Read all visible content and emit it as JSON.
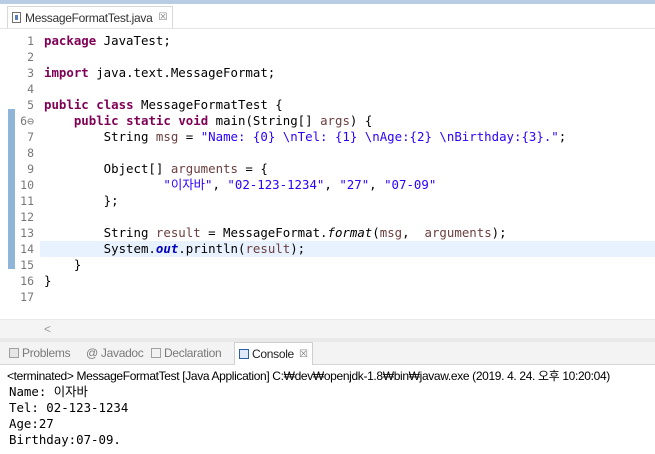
{
  "editor": {
    "tab_label": "MessageFormatTest.java",
    "tab_close_glyph": "☒",
    "hscroll_left_glyph": "<"
  },
  "code_lines": [
    {
      "num": "1",
      "segments": [
        {
          "t": "package",
          "c": "kw"
        },
        {
          "t": " JavaTest;",
          "c": ""
        }
      ]
    },
    {
      "num": "2",
      "segments": []
    },
    {
      "num": "3",
      "segments": [
        {
          "t": "import",
          "c": "kw"
        },
        {
          "t": " java.text.MessageFormat;",
          "c": ""
        }
      ]
    },
    {
      "num": "4",
      "segments": []
    },
    {
      "num": "5",
      "segments": [
        {
          "t": "public",
          "c": "kw"
        },
        {
          "t": " ",
          "c": ""
        },
        {
          "t": "class",
          "c": "kw"
        },
        {
          "t": " MessageFormatTest {",
          "c": ""
        }
      ]
    },
    {
      "num": "6⊖",
      "segments": [
        {
          "t": "    ",
          "c": ""
        },
        {
          "t": "public",
          "c": "kw"
        },
        {
          "t": " ",
          "c": ""
        },
        {
          "t": "static",
          "c": "kw"
        },
        {
          "t": " ",
          "c": ""
        },
        {
          "t": "void",
          "c": "kw"
        },
        {
          "t": " main(String[] ",
          "c": ""
        },
        {
          "t": "args",
          "c": "var"
        },
        {
          "t": ") {",
          "c": ""
        }
      ]
    },
    {
      "num": "7",
      "segments": [
        {
          "t": "        String ",
          "c": ""
        },
        {
          "t": "msg",
          "c": "var"
        },
        {
          "t": " = ",
          "c": ""
        },
        {
          "t": "\"Name: {0} \\nTel: {1} \\nAge:{2} \\nBirthday:{3}.\"",
          "c": "str"
        },
        {
          "t": ";",
          "c": ""
        }
      ]
    },
    {
      "num": "8",
      "segments": []
    },
    {
      "num": "9",
      "segments": [
        {
          "t": "        Object[] ",
          "c": ""
        },
        {
          "t": "arguments",
          "c": "var"
        },
        {
          "t": " = {",
          "c": ""
        }
      ]
    },
    {
      "num": "10",
      "segments": [
        {
          "t": "                ",
          "c": ""
        },
        {
          "t": "\"이자바\"",
          "c": "str"
        },
        {
          "t": ", ",
          "c": ""
        },
        {
          "t": "\"02-123-1234\"",
          "c": "str"
        },
        {
          "t": ", ",
          "c": ""
        },
        {
          "t": "\"27\"",
          "c": "str"
        },
        {
          "t": ", ",
          "c": ""
        },
        {
          "t": "\"07-09\"",
          "c": "str"
        }
      ]
    },
    {
      "num": "11",
      "segments": [
        {
          "t": "        };",
          "c": ""
        }
      ]
    },
    {
      "num": "12",
      "segments": []
    },
    {
      "num": "13",
      "segments": [
        {
          "t": "        String ",
          "c": ""
        },
        {
          "t": "result",
          "c": "var"
        },
        {
          "t": " = MessageFormat.",
          "c": ""
        },
        {
          "t": "format",
          "c": "static-call"
        },
        {
          "t": "(",
          "c": ""
        },
        {
          "t": "msg",
          "c": "var"
        },
        {
          "t": ",  ",
          "c": ""
        },
        {
          "t": "arguments",
          "c": "var"
        },
        {
          "t": ");",
          "c": ""
        }
      ]
    },
    {
      "num": "14",
      "segments": [
        {
          "t": "        System.",
          "c": ""
        },
        {
          "t": "out",
          "c": "static-field"
        },
        {
          "t": ".println(",
          "c": ""
        },
        {
          "t": "result",
          "c": "var"
        },
        {
          "t": ");",
          "c": ""
        }
      ],
      "highlight": true
    },
    {
      "num": "15",
      "segments": [
        {
          "t": "    }",
          "c": ""
        }
      ]
    },
    {
      "num": "16",
      "segments": [
        {
          "t": "}",
          "c": ""
        }
      ]
    },
    {
      "num": "17",
      "segments": []
    }
  ],
  "views": {
    "tabs": [
      {
        "label": "Problems",
        "icon": "problems-icon"
      },
      {
        "label": "@ Javadoc",
        "icon": "javadoc-icon"
      },
      {
        "label": "Declaration",
        "icon": "declaration-icon"
      },
      {
        "label": "Console",
        "icon": "console-icon",
        "close": "☒"
      }
    ]
  },
  "console": {
    "header": "<terminated> MessageFormatTest [Java Application] C:₩dev₩openjdk-1.8₩bin₩javaw.exe (2019. 4. 24. 오후 10:20:04)",
    "output": [
      "Name: 이자바",
      "Tel: 02-123-1234",
      "Age:27",
      "Birthday:07-09."
    ]
  },
  "colors": {
    "keyword": "#7f0055",
    "string": "#2a00ff",
    "local_var": "#6a3e3e",
    "static_field": "#0000c0",
    "line_highlight": "#e8f2fe"
  }
}
